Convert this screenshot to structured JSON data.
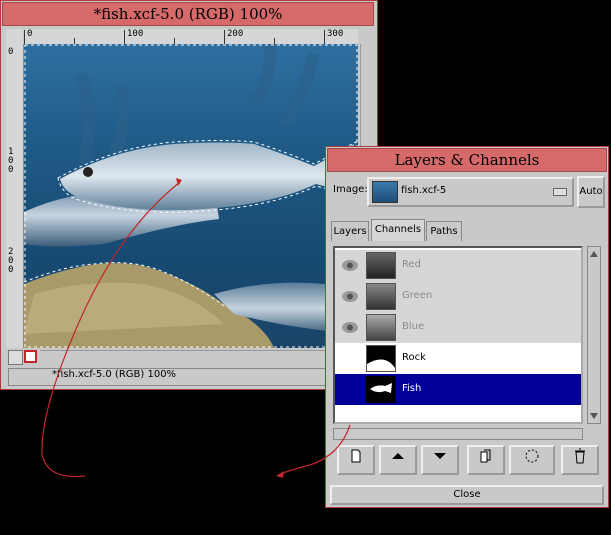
{
  "image_window": {
    "title": "*fish.xcf-5.0 (RGB) 100%",
    "status": "*fish.xcf-5.0 (RGB) 100%",
    "hruler_labels": [
      "0",
      "100",
      "200",
      "300"
    ],
    "vruler_labels": [
      "0",
      "100",
      "200"
    ]
  },
  "layers_dialog": {
    "title": "Layers & Channels",
    "image_label": "Image:",
    "image_name": "fish.xcf-5",
    "auto_label": "Auto",
    "tabs": {
      "layers": "Layers",
      "channels": "Channels",
      "paths": "Paths"
    },
    "active_tab": "Channels",
    "channels": [
      {
        "label": "Red",
        "visible": true,
        "selected": false
      },
      {
        "label": "Green",
        "visible": true,
        "selected": false
      },
      {
        "label": "Blue",
        "visible": true,
        "selected": false
      },
      {
        "label": "Rock",
        "visible": false,
        "selected": false
      },
      {
        "label": "Fish",
        "visible": false,
        "selected": true
      }
    ],
    "buttons": [
      "new-channel-icon",
      "raise-icon",
      "lower-icon",
      "duplicate-icon",
      "channel-to-selection-icon",
      "delete-icon"
    ],
    "close_label": "Close"
  },
  "colors": {
    "title_bar": "#d66a6a",
    "selected_row": "#000099",
    "arrow": "#c0262a"
  }
}
